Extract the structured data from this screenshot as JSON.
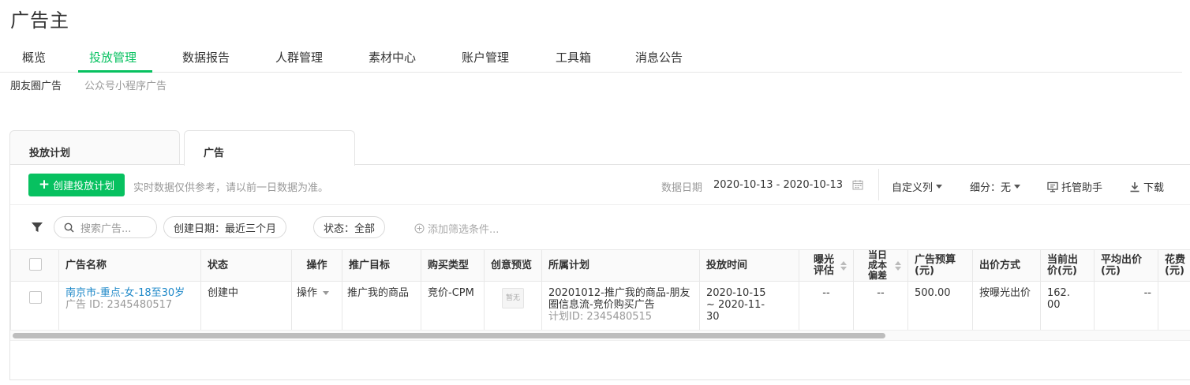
{
  "page_title": "广告主",
  "main_nav": [
    {
      "label": "概览"
    },
    {
      "label": "投放管理",
      "active": true
    },
    {
      "label": "数据报告"
    },
    {
      "label": "人群管理"
    },
    {
      "label": "素材中心"
    },
    {
      "label": "账户管理"
    },
    {
      "label": "工具箱"
    },
    {
      "label": "消息公告"
    }
  ],
  "sub_nav": [
    {
      "label": "朋友圈广告",
      "active": true
    },
    {
      "label": "公众号小程序广告"
    }
  ],
  "tabs": [
    {
      "label": "投放计划"
    },
    {
      "label": "广告",
      "active": true
    }
  ],
  "toolbar": {
    "create_label": "创建投放计划",
    "hint": "实时数据仅供参考，请以前一日数据为准。",
    "date_label": "数据日期",
    "date_range": "2020-10-13 - 2020-10-13",
    "custom_columns": "自定义列",
    "breakdown": "细分：无",
    "assistant": "托管助手",
    "download": "下载"
  },
  "filters": {
    "search_placeholder": "搜索广告...",
    "created_date": "创建日期：最近三个月",
    "status": "状态：全部",
    "add_filter": "添加筛选条件..."
  },
  "table": {
    "headers": {
      "name": "广告名称",
      "status": "状态",
      "action": "操作",
      "goal": "推广目标",
      "buy_type": "购买类型",
      "preview": "创意预览",
      "plan": "所属计划",
      "time": "投放时间",
      "exposure": "曝光评估",
      "cost_dev": "当日成本偏差",
      "budget": "广告预算(元)",
      "bid_method": "出价方式",
      "cur_bid": "当前出价(元)",
      "avg_bid": "平均出价(元)",
      "spend": "花费(元)"
    },
    "row": {
      "name": "南京市-重点-女-18至30岁",
      "ad_id": "广告 ID: 2345480517",
      "status": "创建中",
      "action": "操作",
      "goal": "推广我的商品",
      "buy_type": "竞价-CPM",
      "preview": "暂无",
      "plan": "20201012-推广我的商品-朋友圈信息流-竞价购买广告",
      "plan_id": "计划ID: 2345480515",
      "time": "2020-10-15 ~ 2020-11-30",
      "exposure": "--",
      "cost_dev": "--",
      "budget": "500.00",
      "bid_method": "按曝光出价",
      "cur_bid": "162.00",
      "avg_bid": "--"
    }
  },
  "accent_color": "#07c160",
  "link_color": "#1e88c8"
}
